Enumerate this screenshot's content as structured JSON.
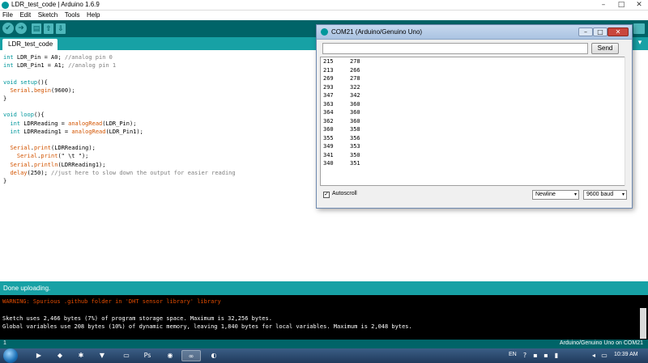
{
  "window": {
    "title": "LDR_test_code | Arduino 1.6.9",
    "controls": {
      "minimize": "–",
      "maximize": "□",
      "close": "✕"
    }
  },
  "menubar": {
    "items": [
      "File",
      "Edit",
      "Sketch",
      "Tools",
      "Help"
    ]
  },
  "toolbar": {
    "buttons": [
      {
        "name": "verify",
        "icon": "check-icon",
        "glyph": "✔"
      },
      {
        "name": "upload",
        "icon": "arrow-right-icon",
        "glyph": "➜"
      },
      {
        "name": "new",
        "icon": "new-file-icon",
        "glyph": "▤"
      },
      {
        "name": "open",
        "icon": "open-icon",
        "glyph": "⇧"
      },
      {
        "name": "save",
        "icon": "save-icon",
        "glyph": "⇩"
      }
    ]
  },
  "tabs": {
    "active": "LDR_test_code",
    "menu_glyph": "▾"
  },
  "editor": {
    "lines": [
      [
        {
          "t": "int",
          "c": "kw"
        },
        {
          "t": " LDR_Pin = A0; "
        },
        {
          "t": "//analog pin 0",
          "c": "cm"
        }
      ],
      [
        {
          "t": "int",
          "c": "kw"
        },
        {
          "t": " LDR_Pin1 = A1; "
        },
        {
          "t": "//analog pin 1",
          "c": "cm"
        }
      ],
      [],
      [
        {
          "t": "void",
          "c": "kw"
        },
        {
          "t": " "
        },
        {
          "t": "setup",
          "c": "kw"
        },
        {
          "t": "(){"
        }
      ],
      [
        {
          "t": "  "
        },
        {
          "t": "Serial",
          "c": "fn"
        },
        {
          "t": "."
        },
        {
          "t": "begin",
          "c": "fn"
        },
        {
          "t": "(9600);"
        }
      ],
      [
        {
          "t": "}"
        }
      ],
      [],
      [
        {
          "t": "void",
          "c": "kw"
        },
        {
          "t": " "
        },
        {
          "t": "loop",
          "c": "kw"
        },
        {
          "t": "(){"
        }
      ],
      [
        {
          "t": "  "
        },
        {
          "t": "int",
          "c": "kw"
        },
        {
          "t": " LDRReading = "
        },
        {
          "t": "analogRead",
          "c": "fn"
        },
        {
          "t": "(LDR_Pin);"
        }
      ],
      [
        {
          "t": "  "
        },
        {
          "t": "int",
          "c": "kw"
        },
        {
          "t": " LDRReading1 = "
        },
        {
          "t": "analogRead",
          "c": "fn"
        },
        {
          "t": "(LDR_Pin1);"
        }
      ],
      [],
      [
        {
          "t": "  "
        },
        {
          "t": "Serial",
          "c": "fn"
        },
        {
          "t": "."
        },
        {
          "t": "print",
          "c": "fn"
        },
        {
          "t": "(LDRReading);"
        }
      ],
      [
        {
          "t": "    "
        },
        {
          "t": "Serial",
          "c": "fn"
        },
        {
          "t": "."
        },
        {
          "t": "print",
          "c": "fn"
        },
        {
          "t": "(\" \\t \");"
        }
      ],
      [
        {
          "t": "  "
        },
        {
          "t": "Serial",
          "c": "fn"
        },
        {
          "t": "."
        },
        {
          "t": "println",
          "c": "fn"
        },
        {
          "t": "(LDRReading1);"
        }
      ],
      [
        {
          "t": "  "
        },
        {
          "t": "delay",
          "c": "fn"
        },
        {
          "t": "(250); "
        },
        {
          "t": "//just here to slow down the output for easier reading",
          "c": "cm"
        }
      ],
      [
        {
          "t": "}"
        }
      ]
    ]
  },
  "serial_monitor": {
    "title": "COM21 (Arduino/Genuino Uno)",
    "input_value": "",
    "send_label": "Send",
    "rows": [
      [
        "215",
        "278"
      ],
      [
        "213",
        "266"
      ],
      [
        "269",
        "278"
      ],
      [
        "293",
        "322"
      ],
      [
        "347",
        "342"
      ],
      [
        "363",
        "360"
      ],
      [
        "364",
        "360"
      ],
      [
        "362",
        "360"
      ],
      [
        "360",
        "358"
      ],
      [
        "355",
        "356"
      ],
      [
        "349",
        "353"
      ],
      [
        "341",
        "350"
      ],
      [
        "340",
        "351"
      ]
    ],
    "autoscroll_label": "Autoscroll",
    "autoscroll_checked": "✓",
    "line_ending": "Newline",
    "baud_rate": "9600 baud",
    "dropdown_glyph": "▾"
  },
  "status": {
    "message": "Done uploading."
  },
  "console": {
    "warning": "WARNING: Spurious .github folder in 'DHT sensor library' library",
    "sketch_size": "Sketch uses 2,466 bytes (7%) of program storage space. Maximum is 32,256 bytes.",
    "global_vars": "Global variables use 208 bytes (10%) of dynamic memory, leaving 1,840 bytes for local variables. Maximum is 2,048 bytes."
  },
  "footer": {
    "line_number": "1",
    "board": "Arduino/Genuino Uno on COM21"
  },
  "taskbar": {
    "items": [
      {
        "name": "media-player",
        "glyph": "▶"
      },
      {
        "name": "app-2",
        "glyph": "◆"
      },
      {
        "name": "app-3",
        "glyph": "✱"
      },
      {
        "name": "app-4",
        "glyph": "▼"
      },
      {
        "name": "app-5",
        "glyph": "▭"
      },
      {
        "name": "photoshop",
        "glyph": "Ps"
      },
      {
        "name": "chrome",
        "glyph": "◉"
      },
      {
        "name": "arduino",
        "glyph": "∞"
      },
      {
        "name": "app-9",
        "glyph": "◐"
      }
    ],
    "language": "EN",
    "clock": "10:39 AM"
  },
  "colors": {
    "arduino_teal_dark": "#006468",
    "arduino_teal": "#17a1a5",
    "keyword": "#00979c",
    "function": "#d35400",
    "warning": "#e34c00"
  }
}
